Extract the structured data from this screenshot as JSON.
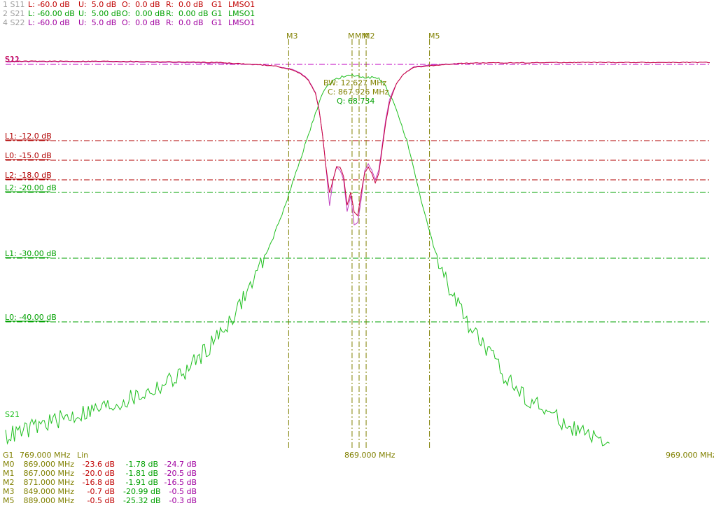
{
  "colors": {
    "s11": "#c8003c",
    "s21": "#20c020",
    "s22": "#c040c0",
    "marker": "#808000",
    "limit_red": "#b00000",
    "limit_green": "#00a000",
    "ref_purple": "#c000c0",
    "status_red": "#c00000",
    "status_green": "#00a000",
    "status_purple": "#a000a0",
    "status_olive": "#808000",
    "dim": "#a0a0a0"
  },
  "traces_header": [
    {
      "id": "1",
      "name": "S11",
      "L": "L: -60.0 dB",
      "U": "U:  5.0 dB",
      "O": "O:  0.0 dB",
      "R": "R:  0.0 dB",
      "G": "G1",
      "cal": "LMSO1",
      "color": "#c00000"
    },
    {
      "id": "2",
      "name": "S21",
      "L": "L: -60.00 dB",
      "U": "U:  5.00 dB",
      "O": "O:  0.00 dB",
      "R": "R:  0.00 dB",
      "G": "G1",
      "cal": "LMSO1",
      "color": "#00a000"
    },
    {
      "id": "4",
      "name": "S22",
      "L": "L: -60.0 dB",
      "U": "U:  5.0 dB",
      "O": "O:  0.0 dB",
      "R": "R:  0.0 dB",
      "G": "G1",
      "cal": "LMSO1",
      "color": "#a000a0"
    }
  ],
  "markers": [
    {
      "label": "M3",
      "x": 849.0
    },
    {
      "label": "M1",
      "x": 867.0
    },
    {
      "label": "M0",
      "x": 869.0
    },
    {
      "label": "M2",
      "x": 871.0
    },
    {
      "label": "M5",
      "x": 889.0
    }
  ],
  "marker_top_text": "M3",
  "marker_top_text_m1": "M",
  "marker_top_text_m0": "MM",
  "marker_top_text_m2": "M2",
  "marker_top_text_m5": "M5",
  "limit_lines": [
    {
      "label": "L1: -12.0 dB",
      "trace": "S11",
      "db": -12.0
    },
    {
      "label": "L0: -15.0 dB",
      "trace": "S11",
      "db": -15.0
    },
    {
      "label": "L2: -18.0 dB",
      "trace": "S11",
      "db": -18.0
    },
    {
      "label": "L2: -20.00 dB",
      "trace": "S21",
      "db": -20.0
    },
    {
      "label": "L1: -30.00 dB",
      "trace": "S21",
      "db": -30.0
    },
    {
      "label": "L0: -40.00 dB",
      "trace": "S21",
      "db": -40.0
    }
  ],
  "bw_info": {
    "bw": "BW:  12.627 MHz",
    "center": "C:  867.926 MHz",
    "q": "Q:  68.734"
  },
  "trace_labels": {
    "s11": "S11",
    "s22": "S22",
    "s21": "S21"
  },
  "axis": {
    "start": "769.000 MHz",
    "center": "869.000 MHz",
    "stop": "969.000 MHz",
    "group": "G1",
    "scale": "Lin"
  },
  "marker_table": [
    {
      "name": "M0",
      "freq": "869.000 MHz",
      "s11": "-23.6 dB",
      "s21": "-1.78 dB",
      "s22": "-24.7 dB"
    },
    {
      "name": "M1",
      "freq": "867.000 MHz",
      "s11": "-20.0 dB",
      "s21": "-1.81 dB",
      "s22": "-20.5 dB"
    },
    {
      "name": "M2",
      "freq": "871.000 MHz",
      "s11": "-16.8 dB",
      "s21": "-1.91 dB",
      "s22": "-16.5 dB"
    },
    {
      "name": "M3",
      "freq": "849.000 MHz",
      "s11": "-0.7 dB",
      "s21": "-20.99 dB",
      "s22": "-0.5 dB"
    },
    {
      "name": "M5",
      "freq": "889.000 MHz",
      "s11": "-0.5 dB",
      "s21": "-25.32 dB",
      "s22": "-0.3 dB"
    }
  ],
  "chart_data": {
    "type": "line",
    "x_range": [
      769,
      969
    ],
    "x_unit": "MHz",
    "ylim": [
      -60,
      5
    ],
    "series": [
      {
        "name": "S11",
        "x": [
          769,
          800,
          830,
          845,
          850,
          853,
          855,
          857,
          858,
          859,
          860,
          861,
          862,
          863,
          864,
          865,
          866,
          867,
          868,
          869,
          870,
          871,
          872,
          873,
          874,
          875,
          876,
          877,
          878,
          880,
          882,
          885,
          890,
          900,
          930,
          969
        ],
        "values": [
          0.5,
          0.5,
          0.3,
          -0.2,
          -0.8,
          -1.5,
          -2.5,
          -4.5,
          -7,
          -11,
          -16,
          -20,
          -18,
          -16,
          -16,
          -17.5,
          -22,
          -20,
          -23,
          -23.6,
          -20,
          -16.8,
          -16,
          -17,
          -18.5,
          -17,
          -13,
          -9,
          -6,
          -3,
          -1.5,
          -0.5,
          -0.2,
          0.2,
          0.3,
          0.3
        ]
      },
      {
        "name": "S21",
        "x": [
          769,
          775,
          780,
          790,
          800,
          810,
          820,
          830,
          835,
          840,
          845,
          849,
          852,
          855,
          858,
          860,
          862,
          865,
          867,
          869,
          871,
          873,
          875,
          877,
          880,
          883,
          886,
          889,
          892,
          895,
          900,
          905,
          910,
          915,
          920,
          925,
          930,
          935,
          940,
          945
        ],
        "values": [
          -58,
          -57,
          -56,
          -54.5,
          -53,
          -51,
          -48,
          -42,
          -38,
          -33,
          -27,
          -21,
          -16,
          -11,
          -6,
          -3.5,
          -2.5,
          -1.9,
          -1.81,
          -1.78,
          -1.91,
          -2.0,
          -2.3,
          -3.5,
          -7,
          -12,
          -19,
          -25.32,
          -31,
          -35,
          -40,
          -44,
          -48,
          -51,
          -53,
          -55,
          -56.5,
          -58,
          -60,
          -62
        ]
      },
      {
        "name": "S22",
        "x": [
          769,
          800,
          830,
          845,
          850,
          853,
          855,
          857,
          858,
          859,
          860,
          861,
          862,
          863,
          864,
          865,
          866,
          867,
          868,
          869,
          870,
          871,
          872,
          873,
          874,
          875,
          876,
          877,
          878,
          880,
          882,
          885,
          890,
          900,
          930,
          969
        ],
        "values": [
          0.4,
          0.4,
          0.2,
          -0.2,
          -0.7,
          -1.4,
          -2.4,
          -4.4,
          -7,
          -11,
          -16,
          -22,
          -18,
          -16,
          -16.5,
          -18,
          -23,
          -20.5,
          -25,
          -24.7,
          -21,
          -16.5,
          -15.5,
          -16.5,
          -18,
          -16.5,
          -12.5,
          -8.5,
          -5.5,
          -3,
          -1.5,
          -0.4,
          -0.1,
          0.2,
          0.3,
          0.3
        ]
      }
    ],
    "title": "",
    "xlabel": "",
    "ylabel": ""
  }
}
